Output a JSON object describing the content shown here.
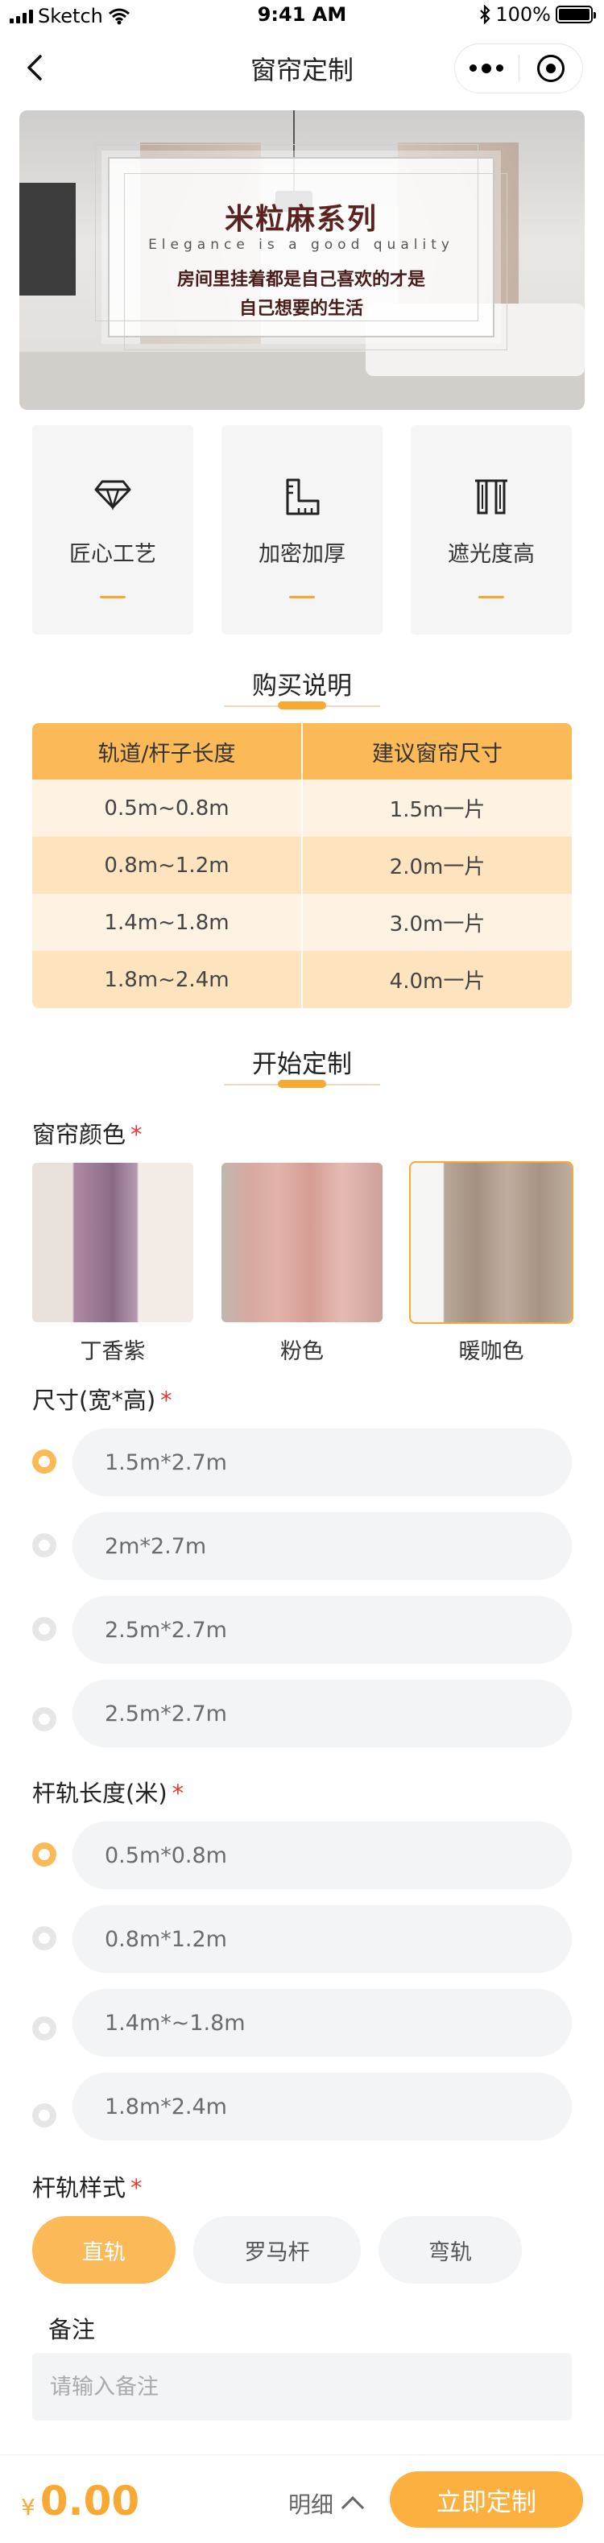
{
  "status_bar": {
    "carrier": "Sketch",
    "time": "9:41 AM",
    "battery": "100%"
  },
  "nav": {
    "title": "窗帘定制"
  },
  "banner": {
    "title": "米粒麻系列",
    "subtitle": "Elegance is a good quality",
    "line1": "房间里挂着都是自己喜欢的才是",
    "line2": "自己想要的生活"
  },
  "features": [
    {
      "label": "匠心工艺",
      "icon": "diamond-icon"
    },
    {
      "label": "加密加厚",
      "icon": "ruler-icon"
    },
    {
      "label": "遮光度高",
      "icon": "curtain-icon"
    }
  ],
  "purchase": {
    "title": "购买说明",
    "headers": [
      "轨道/杆子长度",
      "建议窗帘尺寸"
    ],
    "rows": [
      [
        "0.5m~0.8m",
        "1.5m一片"
      ],
      [
        "0.8m~1.2m",
        "2.0m一片"
      ],
      [
        "1.4m~1.8m",
        "3.0m一片"
      ],
      [
        "1.8m~2.4m",
        "4.0m一片"
      ]
    ]
  },
  "customize": {
    "title": "开始定制"
  },
  "color": {
    "label": "窗帘颜色",
    "required": "*",
    "options": [
      "丁香紫",
      "粉色",
      "暖咖色"
    ],
    "selected": "暖咖色"
  },
  "size": {
    "label": "尺寸(宽*高)",
    "required": "*",
    "options": [
      "1.5m*2.7m",
      "2m*2.7m",
      "2.5m*2.7m",
      "2.5m*2.7m"
    ],
    "selected_index": 0
  },
  "rail_length": {
    "label": "杆轨长度(米)",
    "required": "*",
    "options": [
      "0.5m*0.8m",
      "0.8m*1.2m",
      "1.4m*~1.8m",
      "1.8m*2.4m"
    ],
    "selected_index": 0
  },
  "rail_style": {
    "label": "杆轨样式",
    "required": "*",
    "options": [
      "直轨",
      "罗马杆",
      "弯轨"
    ],
    "selected": "直轨"
  },
  "note": {
    "label": "备注",
    "placeholder": "请输入备注"
  },
  "bottom": {
    "currency": "¥",
    "price": "0.00",
    "detail": "明细",
    "cta": "立即定制"
  },
  "colors": {
    "accent": "#fbb957",
    "price": "#f7a934",
    "required": "#e53935"
  }
}
